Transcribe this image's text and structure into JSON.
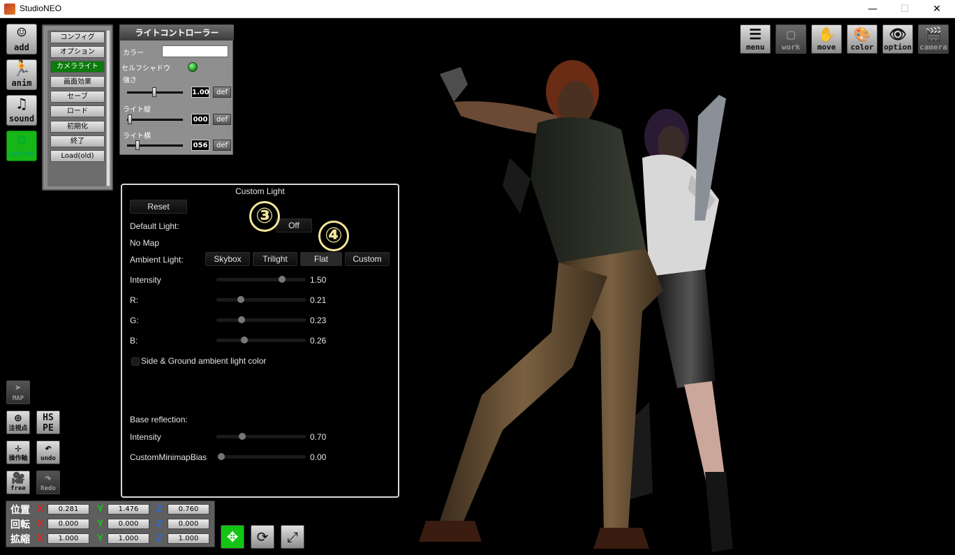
{
  "window": {
    "title": "StudioNEO",
    "min_glyph": "—",
    "max_glyph": "☐",
    "close_glyph": "✕"
  },
  "left_icons": [
    {
      "id": "add",
      "label": "add",
      "icon": "person-icon",
      "glyph": "☺"
    },
    {
      "id": "anim",
      "label": "anim",
      "icon": "running-person-icon",
      "glyph": "🏃"
    },
    {
      "id": "sound",
      "label": "sound",
      "icon": "music-note-icon",
      "glyph": "♫"
    },
    {
      "id": "system",
      "label": "system",
      "icon": "gears-icon",
      "glyph": "⚙"
    }
  ],
  "system_menu": {
    "items": [
      "コンフィグ",
      "オプション",
      "カメラライト",
      "画面効果",
      "セーブ",
      "ロード",
      "初期化",
      "終了",
      "Load(old)"
    ],
    "selected": "カメラライト"
  },
  "light_controller": {
    "title": "ライトコントローラー",
    "color_label": "カラー",
    "self_shadow_label": "セルフシャドウ",
    "strength_label": "強さ",
    "strength_value": "1.00",
    "strength_level": 0.5,
    "vertical_label": "ライト縦",
    "vertical_value": "000",
    "vertical_level": 0.0,
    "horizontal_label": "ライト横",
    "horizontal_value": "056",
    "horizontal_level": 0.16,
    "def_label": "def",
    "color_value": "#ffffff"
  },
  "custom_light": {
    "title": "Custom Light",
    "reset_label": "Reset",
    "default_light_label": "Default Light:",
    "default_light_value": "Off",
    "no_map_label": "No Map",
    "ambient_light_label": "Ambient Light:",
    "ambient_options": [
      "Skybox",
      "Trilight",
      "Flat",
      "Custom"
    ],
    "ambient_selected": "Flat",
    "sliders": [
      {
        "label": "Intensity",
        "value": "1.50",
        "level": 0.75
      },
      {
        "label": "R:",
        "value": "0.21",
        "level": 0.25
      },
      {
        "label": "G:",
        "value": "0.23",
        "level": 0.26
      },
      {
        "label": "B:",
        "value": "0.26",
        "level": 0.3
      }
    ],
    "side_ground_label": "Side & Ground ambient light color",
    "base_reflection_label": "Base reflection:",
    "reflection_intensity": {
      "label": "Intensity",
      "value": "0.70",
      "level": 0.27
    },
    "minimap_bias": {
      "label": "CustomMinimapBias",
      "value": "0.00",
      "level": 0.0
    }
  },
  "annotations": {
    "three": "③",
    "four": "④"
  },
  "right_toolbar": [
    {
      "id": "menu",
      "label": "menu",
      "icon": "list-icon",
      "glyph": "☰",
      "enabled": true
    },
    {
      "id": "work",
      "label": "work",
      "icon": "window-icon",
      "glyph": "▢",
      "enabled": false
    },
    {
      "id": "move",
      "label": "move",
      "icon": "hand-icon",
      "glyph": "✋",
      "enabled": true
    },
    {
      "id": "color",
      "label": "color",
      "icon": "palette-icon",
      "glyph": "🎨",
      "enabled": true
    },
    {
      "id": "option",
      "label": "option",
      "icon": "eye-icon",
      "glyph": "👁",
      "enabled": true
    },
    {
      "id": "camera",
      "label": "camera",
      "icon": "clapperboard-icon",
      "glyph": "🎬",
      "enabled": false
    }
  ],
  "small_icons": {
    "map": {
      "label": "MAP",
      "glyph": "➤"
    },
    "focus": {
      "label": "注視点",
      "glyph": "⊕"
    },
    "hspe": {
      "label": "HS PE"
    },
    "axis": {
      "label": "操作軸",
      "glyph": "✛"
    },
    "undo": {
      "label": "undo",
      "glyph": "↶"
    },
    "free": {
      "label": "free",
      "glyph": "🎥"
    },
    "redo": {
      "label": "Redo",
      "glyph": "↷"
    }
  },
  "transform": {
    "rows": [
      {
        "label": "位置",
        "x": "0.281",
        "y": "1.476",
        "z": "0.760"
      },
      {
        "label": "回転",
        "x": "0.000",
        "y": "0.000",
        "z": "0.000"
      },
      {
        "label": "拡縮",
        "x": "1.000",
        "y": "1.000",
        "z": "1.000"
      }
    ],
    "axis_x": "X",
    "axis_y": "Y",
    "axis_z": "Z",
    "colors": {
      "x": "#e52020",
      "y": "#19c419",
      "z": "#2a6ae0"
    }
  },
  "bottom_tools": [
    {
      "id": "move-tool",
      "icon": "move-arrows-icon",
      "glyph": "✥",
      "active": true
    },
    {
      "id": "rotate-tool",
      "icon": "rotate-icon",
      "glyph": "⟳",
      "active": false
    },
    {
      "id": "scale-tool",
      "icon": "scale-icon",
      "glyph": "⤢",
      "active": false
    }
  ]
}
